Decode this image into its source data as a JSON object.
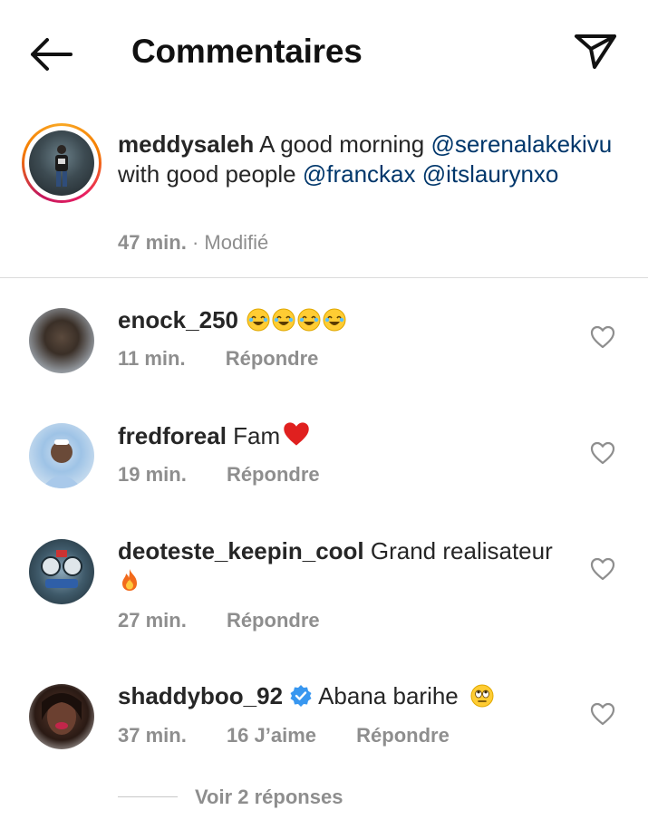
{
  "header": {
    "title": "Commentaires"
  },
  "caption": {
    "username": "meddysaleh",
    "text_1": " A good morning ",
    "mention_1": "@serenalakekivu",
    "text_2": " with good people ",
    "mention_2": "@franckax",
    "mention_3": "@itslaurynxo",
    "time": "47 min.",
    "edited": "· Modifié"
  },
  "comments": [
    {
      "username": "enock_250",
      "text": "",
      "emojis": [
        "laugh-cry",
        "laugh-cry",
        "laugh-cry",
        "laugh-cry"
      ],
      "time": "11 min.",
      "reply_label": "Répondre"
    },
    {
      "username": "fredforeal",
      "text": " Fam",
      "emojis": [
        "red-heart"
      ],
      "time": "19 min.",
      "reply_label": "Répondre"
    },
    {
      "username": "deoteste_keepin_cool",
      "text": " Grand realisateur",
      "emojis": [
        "fire"
      ],
      "time": "27 min.",
      "reply_label": "Répondre"
    },
    {
      "username": "shaddyboo_92",
      "verified": true,
      "text": " Abana barihe",
      "emojis": [
        "rolling-eyes"
      ],
      "time": "37 min.",
      "likes": "16 J’aime",
      "reply_label": "Répondre"
    }
  ],
  "replies": {
    "label": "Voir 2 réponses"
  },
  "colors": {
    "mention": "#00376b",
    "meta": "#8e8e8e",
    "verified": "#3897f0",
    "divider": "#dbdbdb"
  }
}
